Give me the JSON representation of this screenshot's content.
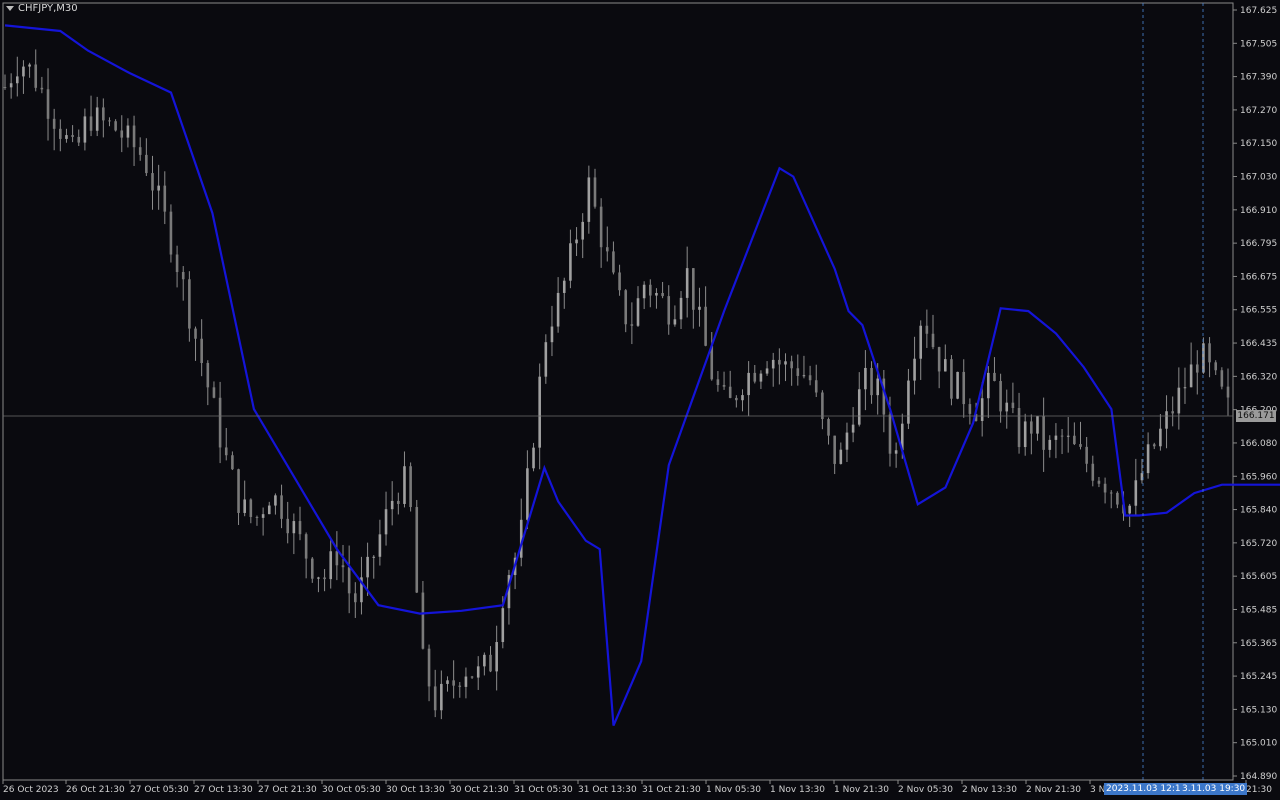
{
  "header": {
    "symbol_label": "CHFJPY,M30"
  },
  "price_tag": "166.171",
  "crosshair_tags": [
    "2023.11.03 12:15",
    "3.11.03 19:30"
  ],
  "colors": {
    "background": "#0a0a0f",
    "candles": "#8c8c8c",
    "indicator": "#1414d8",
    "grid_frame": "#8a8a8a",
    "crosshair": "#4a86d6"
  },
  "chart_data": {
    "type": "candlestick",
    "title": "",
    "symbol": "CHFJPY",
    "timeframe": "M30",
    "ylim": [
      164.89,
      167.625
    ],
    "y_ticks": [
      "167.625",
      "167.505",
      "167.390",
      "167.270",
      "167.150",
      "167.030",
      "166.910",
      "166.795",
      "166.675",
      "166.555",
      "166.435",
      "166.320",
      "166.200",
      "166.080",
      "165.960",
      "165.840",
      "165.720",
      "165.605",
      "165.485",
      "165.365",
      "165.245",
      "165.130",
      "165.010",
      "164.890"
    ],
    "x_ticks": [
      "26 Oct 2023",
      "26 Oct 21:30",
      "27 Oct 05:30",
      "27 Oct 13:30",
      "27 Oct 21:30",
      "30 Oct 05:30",
      "30 Oct 13:30",
      "30 Oct 21:30",
      "31 Oct 05:30",
      "31 Oct 13:30",
      "31 Oct 21:30",
      "1 Nov 05:30",
      "1 Nov 13:30",
      "1 Nov 21:30",
      "2 Nov 05:30",
      "2 Nov 13:30",
      "2 Nov 21:30",
      "3 N",
      "21:30"
    ],
    "last_price": 166.171,
    "close_series": [
      167.35,
      167.45,
      167.4,
      167.3,
      167.2,
      167.1,
      167.25,
      167.22,
      167.2,
      167.15,
      167.1,
      166.95,
      166.8,
      166.6,
      166.4,
      166.2,
      166.0,
      165.85,
      165.8,
      165.9,
      165.85,
      165.75,
      165.65,
      165.6,
      165.7,
      165.5,
      165.6,
      165.75,
      165.9,
      165.95,
      165.3,
      165.15,
      165.2,
      165.28,
      165.25,
      165.3,
      165.6,
      165.7,
      166.1,
      166.5,
      166.6,
      166.8,
      167.0,
      166.8,
      166.6,
      166.5,
      166.65,
      166.6,
      166.55,
      166.7,
      166.5,
      166.3,
      166.2,
      166.3,
      166.35,
      166.4,
      166.35,
      166.35,
      166.3,
      166.1,
      166.0,
      166.2,
      166.3,
      166.25,
      166.0,
      166.35,
      166.55,
      166.4,
      166.3,
      166.25,
      166.2,
      166.3,
      166.2,
      166.1,
      166.15,
      166.05,
      166.1,
      166.05,
      166.0,
      165.95,
      165.9,
      165.85,
      166.0,
      166.1,
      166.2,
      166.3,
      166.4,
      166.3,
      166.2
    ],
    "series": [
      {
        "name": "",
        "color": "#1414d8",
        "x": [
          0,
          4,
          6,
          9,
          12,
          15,
          18,
          21,
          24,
          27,
          30,
          33,
          36,
          39,
          40,
          41,
          42,
          43,
          44,
          46,
          48,
          52,
          56,
          57,
          60,
          61,
          62,
          64,
          66,
          68,
          70,
          72,
          74,
          76,
          78,
          80,
          81,
          82,
          84,
          86,
          88,
          90,
          92,
          94,
          95,
          96
        ],
        "values": [
          167.57,
          167.55,
          167.48,
          167.4,
          167.33,
          166.9,
          166.2,
          165.95,
          165.7,
          165.5,
          165.47,
          165.48,
          165.5,
          165.99,
          165.87,
          165.8,
          165.73,
          165.7,
          165.07,
          165.3,
          166.0,
          166.55,
          167.06,
          167.03,
          166.7,
          166.55,
          166.5,
          166.2,
          165.86,
          165.92,
          166.15,
          166.56,
          166.55,
          166.47,
          166.35,
          166.2,
          165.82,
          165.82,
          165.83,
          165.9,
          165.93,
          165.93,
          165.93,
          165.93,
          165.93,
          165.93
        ]
      }
    ]
  }
}
